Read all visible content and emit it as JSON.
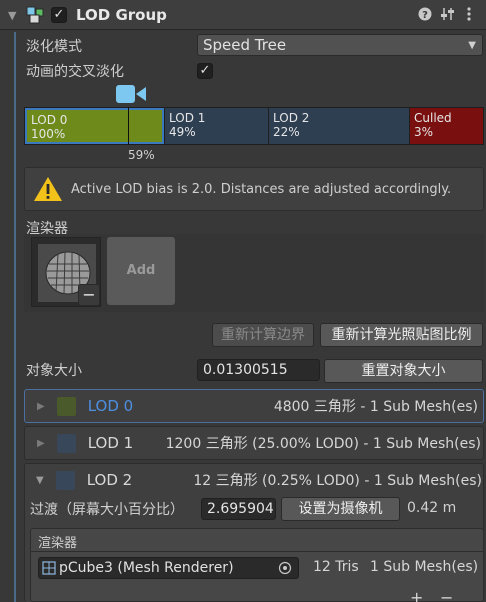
{
  "header": {
    "fold_icon": "chevron-down-icon",
    "component_icon": "lod-group-icon",
    "enabled": true,
    "title": "LOD Group",
    "help_icon": "help-icon",
    "preset_icon": "sliders-icon",
    "menu_icon": "kebab-menu-icon"
  },
  "fade": {
    "mode_label": "淡化模式",
    "mode_value": "Speed Tree",
    "animate_label": "动画的交叉淡化",
    "animate_checked": true
  },
  "lod_bar": {
    "segments": [
      {
        "name": "LOD 0",
        "pct": "100%",
        "color": "#6e8a1a"
      },
      {
        "name": "LOD 1",
        "pct": "49%",
        "color": "#2e3f52"
      },
      {
        "name": "LOD 2",
        "pct": "22%",
        "color": "#2e3f52"
      },
      {
        "name": "Culled",
        "pct": "3%",
        "color": "#7a0f0f"
      }
    ],
    "camera_pct": "59%",
    "camera_icon": "camera-icon"
  },
  "warning": {
    "icon": "warning-icon",
    "text": "Active LOD bias is 2.0. Distances are adjusted accordingly."
  },
  "renderers": {
    "title": "渲染器",
    "add_label": "Add",
    "remove_label": "−"
  },
  "buttons": {
    "recalc_bounds": "重新计算边界",
    "recalc_lightmap": "重新计算光照贴图比例"
  },
  "object_size": {
    "label": "对象大小",
    "value": "0.01300515",
    "reset_label": "重置对象大小"
  },
  "lods": [
    {
      "name": "LOD 0",
      "info": "4800 三角形  - 1 Sub Mesh(es)",
      "color": "#4a5a2a",
      "expanded": false
    },
    {
      "name": "LOD 1",
      "info": "1200 三角形 (25.00% LOD0) - 1 Sub Mesh(es)",
      "color": "#38475a",
      "expanded": false
    },
    {
      "name": "LOD 2",
      "info": "12 三角形 (0.25% LOD0) - 1 Sub Mesh(es)",
      "color": "#38475a",
      "expanded": true
    }
  ],
  "lod2_detail": {
    "transition_label": "过渡（屏幕大小百分比）",
    "transition_value": "2.695904",
    "set_camera_label": "设置为摄像机",
    "distance": "0.42 m",
    "renderers_title": "渲染器",
    "renderer_name": "pCube3 (Mesh Renderer)",
    "renderer_tris": "12 Tris",
    "renderer_submesh": "1 Sub Mesh(es)",
    "add_button": "+",
    "remove_button": "−"
  }
}
